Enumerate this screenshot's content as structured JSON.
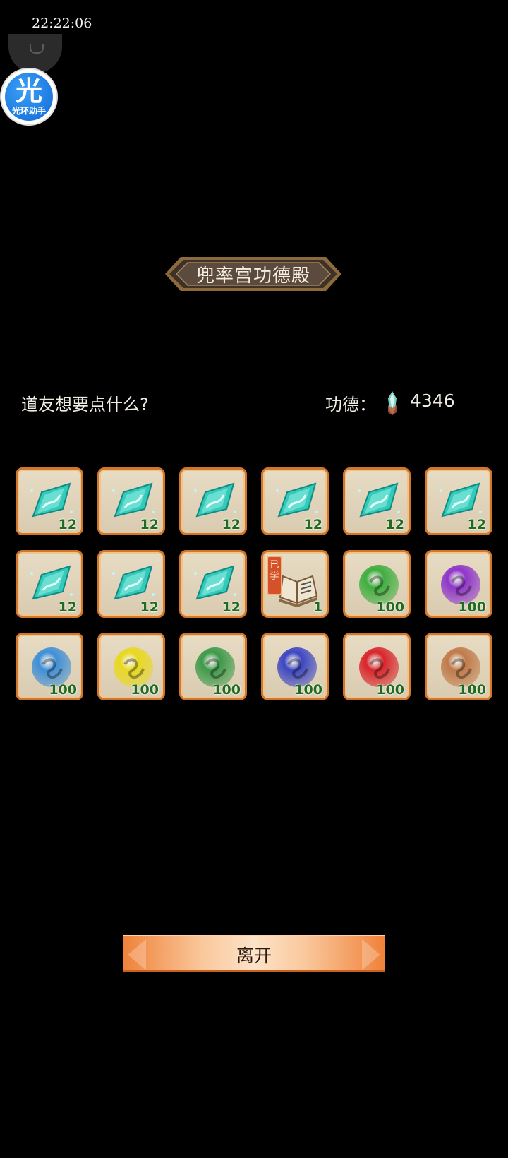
{
  "status_bar": {
    "time": "22:22:06"
  },
  "assistant": {
    "glyph": "光",
    "label": "光环助手"
  },
  "header": {
    "title": "兜率宫功德殿"
  },
  "prompt": "道友想要点什么?",
  "merit": {
    "label": "功德：",
    "value": "4346",
    "icon": "merit-crystal-icon"
  },
  "shop": {
    "items": [
      {
        "icon": "cyan-crystal-icon",
        "qty": "12",
        "color": "#34c9b8"
      },
      {
        "icon": "cyan-crystal-icon",
        "qty": "12",
        "color": "#34c9b8"
      },
      {
        "icon": "cyan-crystal-icon",
        "qty": "12",
        "color": "#34c9b8"
      },
      {
        "icon": "cyan-crystal-icon",
        "qty": "12",
        "color": "#34c9b8"
      },
      {
        "icon": "cyan-crystal-icon",
        "qty": "12",
        "color": "#34c9b8"
      },
      {
        "icon": "cyan-crystal-icon",
        "qty": "12",
        "color": "#34c9b8"
      },
      {
        "icon": "cyan-crystal-icon",
        "qty": "12",
        "color": "#34c9b8"
      },
      {
        "icon": "cyan-crystal-icon",
        "qty": "12",
        "color": "#34c9b8"
      },
      {
        "icon": "cyan-crystal-icon",
        "qty": "12",
        "color": "#34c9b8"
      },
      {
        "icon": "skill-book-icon",
        "qty": "1",
        "tag": "已学",
        "color": "#8a6a45"
      },
      {
        "icon": "green-orb-icon",
        "qty": "100",
        "color": "#3fae3f"
      },
      {
        "icon": "purple-orb-icon",
        "qty": "100",
        "color": "#8e35c9"
      },
      {
        "icon": "blue-orb-icon",
        "qty": "100",
        "color": "#3f8fd6"
      },
      {
        "icon": "yellow-orb-icon",
        "qty": "100",
        "color": "#e8d820"
      },
      {
        "icon": "green-orb-icon",
        "qty": "100",
        "color": "#3d9a4a"
      },
      {
        "icon": "indigo-orb-icon",
        "qty": "100",
        "color": "#3c46c2"
      },
      {
        "icon": "red-orb-icon",
        "qty": "100",
        "color": "#d8252b"
      },
      {
        "icon": "brown-orb-icon",
        "qty": "100",
        "color": "#c07a4a"
      }
    ]
  },
  "leave_button": {
    "label": "离开"
  }
}
